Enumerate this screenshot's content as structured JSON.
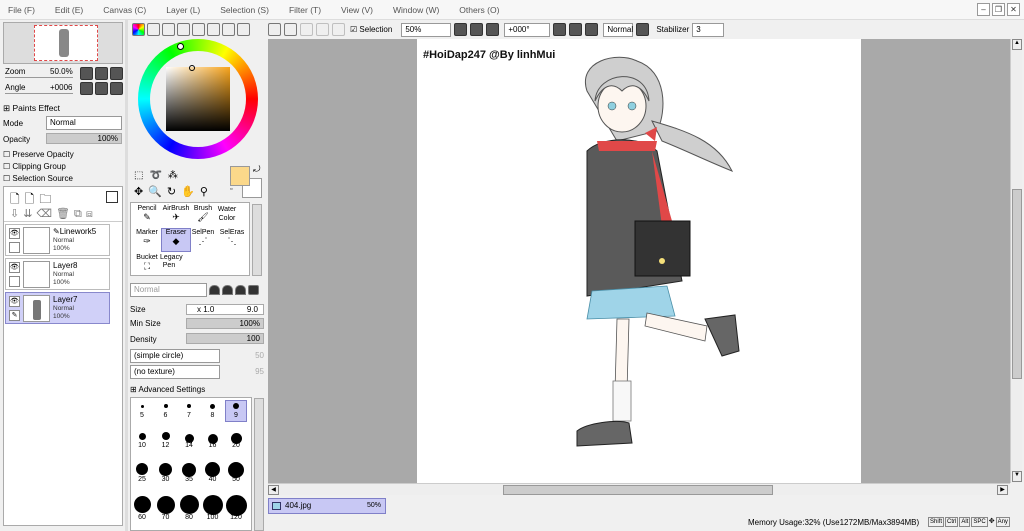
{
  "menu": {
    "items": [
      "File (F)",
      "Edit (E)",
      "Canvas (C)",
      "Layer (L)",
      "Selection (S)",
      "Filter (T)",
      "View (V)",
      "Window (W)",
      "Others (O)"
    ]
  },
  "navigator": {
    "zoom_label": "Zoom",
    "zoom_value": "50.0%",
    "angle_label": "Angle",
    "angle_value": "+0006"
  },
  "paints_effect": {
    "title": "Paints Effect",
    "mode_label": "Mode",
    "mode_value": "Normal",
    "opacity_label": "Opacity",
    "opacity_value": "100%",
    "preserve_opacity": "Preserve Opacity",
    "clipping_group": "Clipping Group",
    "selection_source": "Selection Source"
  },
  "layers": [
    {
      "name": "Linework5",
      "mode": "Normal",
      "opacity": "100%"
    },
    {
      "name": "Layer8",
      "mode": "Normal",
      "opacity": "100%"
    },
    {
      "name": "Layer7",
      "mode": "Normal",
      "opacity": "100%"
    }
  ],
  "tools": {
    "pencil": "Pencil",
    "airbrush": "AirBrush",
    "brush": "Brush",
    "water_color": "Water Color",
    "marker": "Marker",
    "eraser": "Eraser",
    "selpen": "SelPen",
    "seleras": "SelEras",
    "bucket": "Bucket",
    "legacy_pen": "Legacy Pen"
  },
  "brush": {
    "blend_mode": "Normal",
    "size_label": "Size",
    "size_mult": "x 1.0",
    "size_value": "9.0",
    "min_size_label": "Min Size",
    "min_size_value": "100%",
    "density_label": "Density",
    "density_value": "100",
    "shape": "(simple circle)",
    "shape_value": "50",
    "texture": "(no texture)",
    "texture_value": "95",
    "advanced": "Advanced Settings"
  },
  "dot_sizes": [
    [
      "5",
      "6",
      "7",
      "8",
      "9"
    ],
    [
      "10",
      "12",
      "14",
      "16",
      "20"
    ],
    [
      "25",
      "30",
      "35",
      "40",
      "50"
    ],
    [
      "60",
      "70",
      "80",
      "100",
      "120"
    ]
  ],
  "toolbar": {
    "selection_label": "Selection",
    "zoom": "50%",
    "angle": "+000°",
    "mode": "Normal",
    "stabilizer_label": "Stabilizer",
    "stabilizer_value": "3"
  },
  "canvas": {
    "watermark": "#HoiDap247 @By linhMui"
  },
  "tab": {
    "filename": "404.jpg",
    "zoom": "50%"
  },
  "status": {
    "memory": "Memory Usage:32% (Use1272MB/Max3894MB)",
    "keys": [
      "Shift",
      "Ctrl",
      "Alt",
      "SPC",
      "Any"
    ]
  },
  "colors": {
    "primary": "#fbd88a",
    "hair": "#c8c8c8",
    "coat": "#5a5a5a",
    "skirt": "#9fd4e8",
    "accent": "#e04848"
  }
}
